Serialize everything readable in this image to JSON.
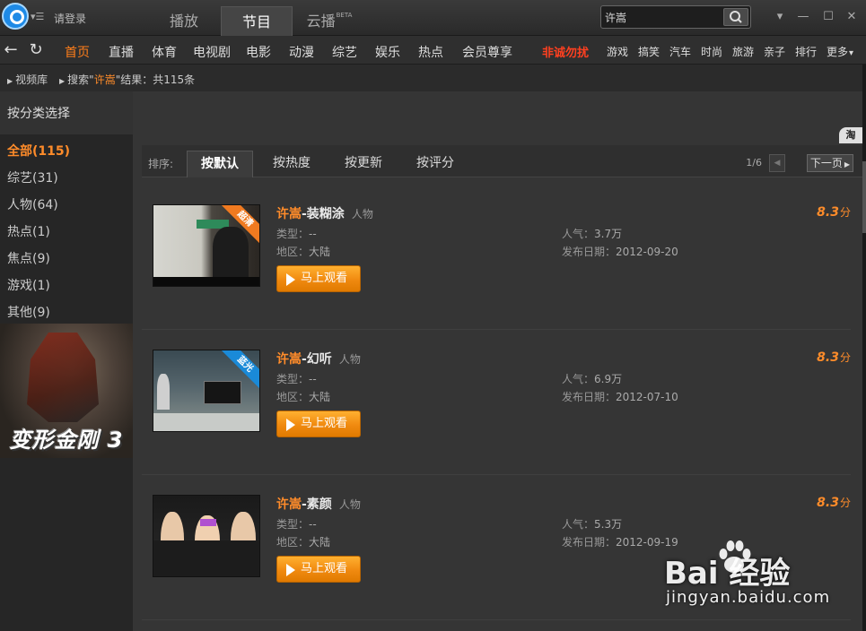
{
  "titlebar": {
    "login": "请登录",
    "tabs": [
      {
        "label": "播放"
      },
      {
        "label": "节目"
      },
      {
        "label": "云播",
        "badge": "BETA"
      }
    ],
    "search_value": "许嵩"
  },
  "nav": {
    "items": [
      "首页",
      "直播",
      "体育",
      "电视剧",
      "电影",
      "动漫",
      "综艺",
      "娱乐",
      "热点",
      "会员尊享"
    ],
    "hot": "非诚勿扰",
    "small_items": [
      "游戏",
      "搞笑",
      "汽车",
      "时尚",
      "旅游",
      "亲子",
      "排行",
      "更多"
    ]
  },
  "breadcrumb": {
    "library": "视频库",
    "search_prefix": "搜索\"",
    "keyword": "许嵩",
    "search_suffix": "\"结果：共115条"
  },
  "sidebar": {
    "heading": "按分类选择",
    "categories": [
      "全部(115)",
      "综艺(31)",
      "人物(64)",
      "热点(1)",
      "焦点(9)",
      "游戏(1)",
      "其他(9)"
    ],
    "poster_title": "变形金刚 3"
  },
  "toolbar": {
    "tao_badge": "淘",
    "sort_label": "排序:",
    "sort_tabs": [
      "按默认",
      "按热度",
      "按更新",
      "按评分"
    ],
    "page_info": "1/6",
    "next_label": "下一页"
  },
  "labels": {
    "type": "类型：",
    "region": "地区：",
    "popularity": "人气：",
    "release": "发布日期：",
    "watch": "马上观看",
    "score_unit": "分"
  },
  "results": [
    {
      "keyword": "许嵩",
      "rest": "-装糊涂",
      "tag": "人物",
      "type": "--",
      "region": "大陆",
      "popularity": "3.7万",
      "release": "2012-09-20",
      "score": "8.3",
      "ribbon": "超清"
    },
    {
      "keyword": "许嵩",
      "rest": "-幻听",
      "tag": "人物",
      "type": "--",
      "region": "大陆",
      "popularity": "6.9万",
      "release": "2012-07-10",
      "score": "8.3",
      "ribbon": "蓝光"
    },
    {
      "keyword": "许嵩",
      "rest": "-素颜",
      "tag": "人物",
      "type": "--",
      "region": "大陆",
      "popularity": "5.3万",
      "release": "2012-09-19",
      "score": "8.3",
      "ribbon": ""
    }
  ],
  "watermark": {
    "logo": "Bai  经验",
    "url": "jingyan.baidu.com"
  },
  "colors": {
    "accent": "#ff8c2a",
    "hot": "#ff4020",
    "background": "#2b2b2b"
  }
}
